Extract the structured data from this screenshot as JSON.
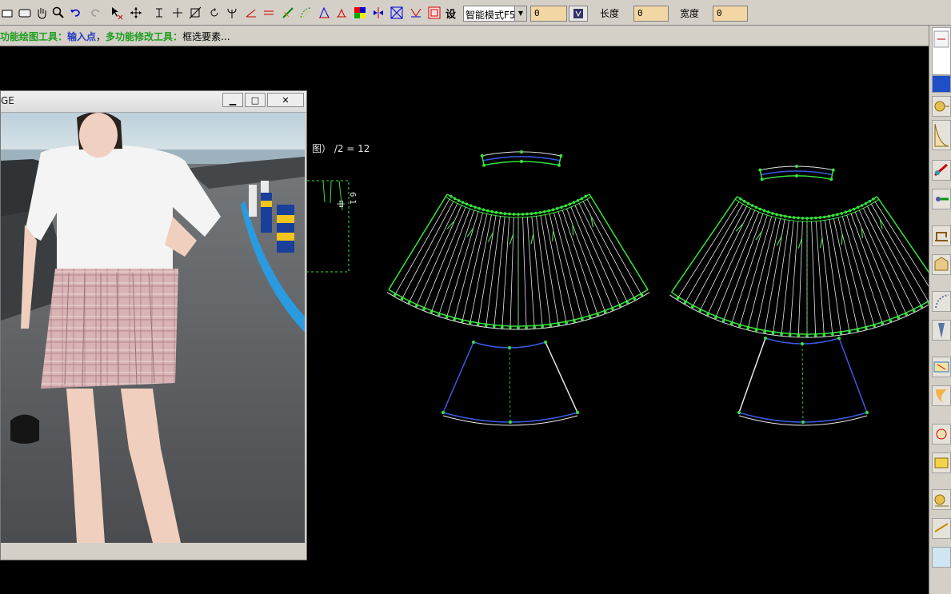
{
  "toolbar": {
    "mode_select": "智能模式F5",
    "field1_value": "0",
    "length_label": "长度",
    "length_value": "0",
    "width_label": "宽度",
    "width_value": "0",
    "set_label": "设"
  },
  "status": {
    "tool_label": "多功能绘图工具：",
    "action1": "输入点",
    "separator": "，",
    "tool2": "多功能修改工具：",
    "action2": "框选要素..."
  },
  "image_window": {
    "title": "GE",
    "min_label": "▁",
    "max_label": "□",
    "close_label": "✕"
  },
  "cad": {
    "annotation": "图） /2 = 12",
    "side_label": "6 1",
    "side_label2": "中"
  },
  "colors": {
    "pattern_green": "#35e33c",
    "pattern_blue": "#3a5be0",
    "pleat_lines": "#e6e6e6",
    "accent_tan": "#f2d6a4"
  }
}
